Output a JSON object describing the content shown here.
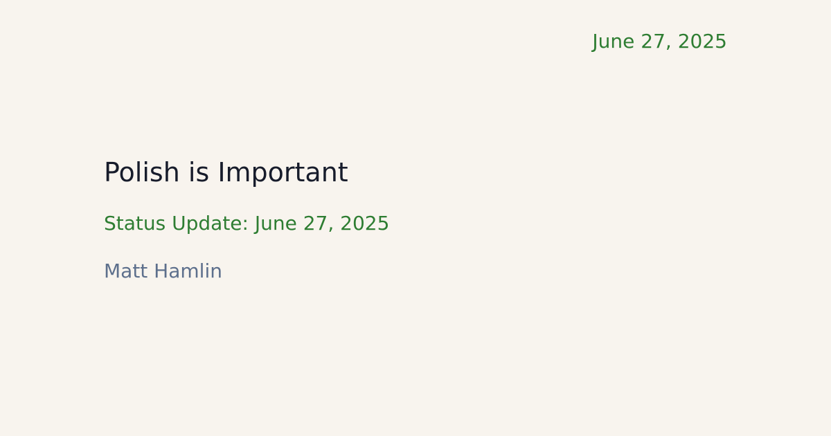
{
  "card": {
    "date": "June 27, 2025",
    "title": "Polish is Important",
    "subtitle": "Status Update: June 27, 2025",
    "author": "Matt Hamlin"
  },
  "colors": {
    "background": "#f8f4ee",
    "title": "#171c2b",
    "accent_green": "#2e7d32",
    "author": "#5d6f8c"
  }
}
